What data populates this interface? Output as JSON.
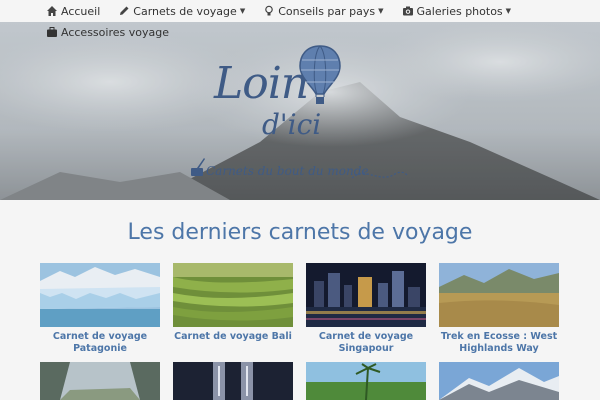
{
  "nav": {
    "row1": [
      {
        "label": "Accueil",
        "icon": "home-icon",
        "dropdown": false
      },
      {
        "label": "Carnets de voyage",
        "icon": "pencil-icon",
        "dropdown": true
      },
      {
        "label": "Conseils par pays",
        "icon": "lightbulb-icon",
        "dropdown": true
      },
      {
        "label": "Galeries photos",
        "icon": "camera-icon",
        "dropdown": true
      }
    ],
    "row2": [
      {
        "label": "Accessoires voyage",
        "icon": "suitcase-icon",
        "dropdown": false
      }
    ]
  },
  "hero": {
    "logo_line1": "Loin",
    "logo_line2": "d'ici",
    "tagline": "Carnets du bout du monde"
  },
  "section": {
    "title": "Les derniers carnets de voyage"
  },
  "cards": [
    {
      "caption": "Carnet de voyage Patagonie"
    },
    {
      "caption": "Carnet de voyage Bali"
    },
    {
      "caption": "Carnet de voyage Singapour"
    },
    {
      "caption": "Trek en Ecosse : West Highlands Way"
    }
  ],
  "colors": {
    "accent": "#4d76a8",
    "logo": "#3f5b86",
    "background": "#f5f5f5"
  }
}
